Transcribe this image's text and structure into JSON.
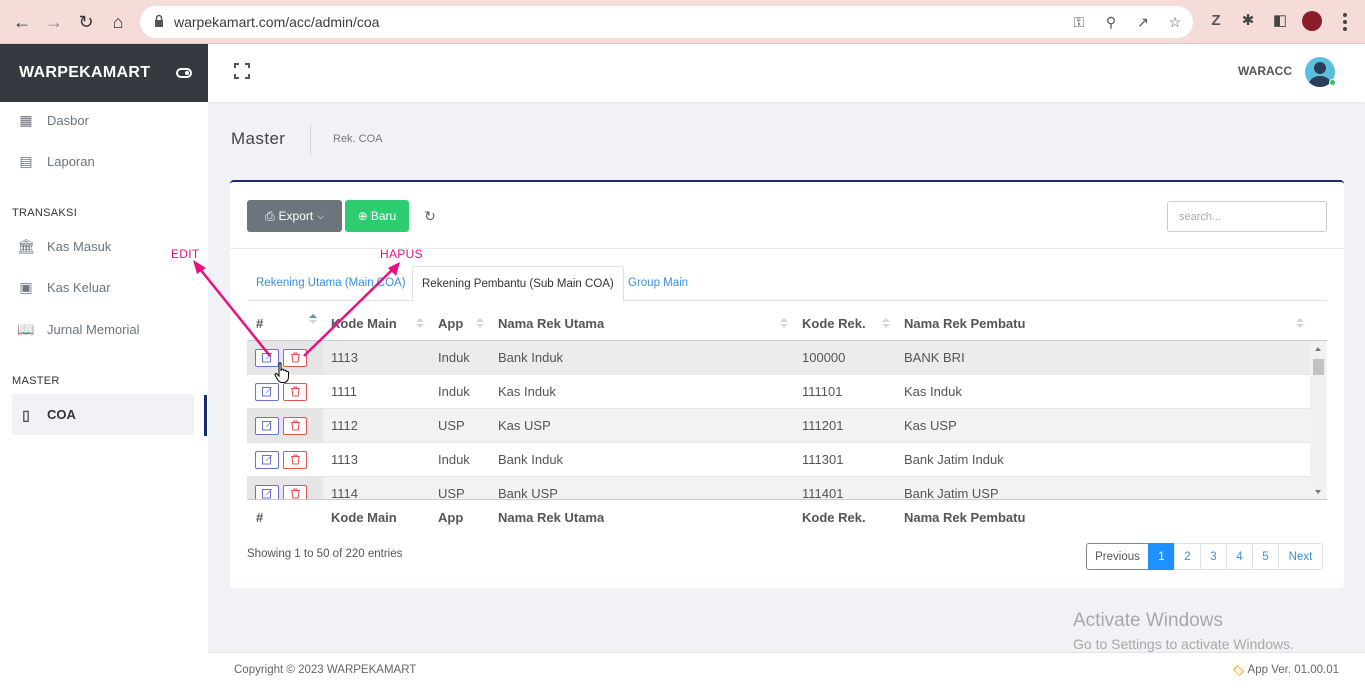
{
  "browser": {
    "url": "warpekamart.com/acc/admin/coa"
  },
  "sidebar": {
    "brand": "WARPEKAMART",
    "items_top": [
      {
        "label": "Dasbor",
        "icon": "dashboard-icon"
      },
      {
        "label": "Laporan",
        "icon": "clipboard-icon"
      }
    ],
    "section_transaksi": "TRANSAKSI",
    "items_transaksi": [
      {
        "label": "Kas Masuk",
        "icon": "bank-icon"
      },
      {
        "label": "Kas Keluar",
        "icon": "money-icon"
      },
      {
        "label": "Jurnal Memorial",
        "icon": "book-icon"
      }
    ],
    "section_master": "MASTER",
    "items_master": [
      {
        "label": "COA",
        "icon": "notebook-icon",
        "active": true
      }
    ]
  },
  "topbar": {
    "user": "WARACC"
  },
  "page": {
    "title": "Master",
    "crumb": "Rek. COA"
  },
  "toolbar": {
    "export_label": "Export",
    "baru_label": "Baru",
    "search_placeholder": "search..."
  },
  "tabs": [
    {
      "label": "Rekening Utama (Main COA)",
      "active": false
    },
    {
      "label": "Rekening Pembantu (Sub Main COA)",
      "active": true
    },
    {
      "label": "Group Main",
      "active": false
    }
  ],
  "table": {
    "columns": [
      "#",
      "Kode Main",
      "App",
      "Nama Rek Utama",
      "Kode Rek.",
      "Nama Rek Pembatu"
    ],
    "rows": [
      [
        "1113",
        "Induk",
        "Bank Induk",
        "100000",
        "BANK BRI"
      ],
      [
        "1111",
        "Induk",
        "Kas Induk",
        "111101",
        "Kas Induk"
      ],
      [
        "1112",
        "USP",
        "Kas USP",
        "111201",
        "Kas USP"
      ],
      [
        "1113",
        "Induk",
        "Bank Induk",
        "111301",
        "Bank Jatim Induk"
      ],
      [
        "1114",
        "USP",
        "Bank USP",
        "111401",
        "Bank Jatim USP"
      ]
    ]
  },
  "info": "Showing 1 to 50 of 220 entries",
  "pagination": {
    "previous": "Previous",
    "pages": [
      "1",
      "2",
      "3",
      "4",
      "5"
    ],
    "current": "1",
    "next": "Next"
  },
  "footer": {
    "copyright": "Copyright © 2023 WARPEKAMART",
    "version": "App Ver. 01.00.01"
  },
  "watermark": {
    "line1": "Activate Windows",
    "line2": "Go to Settings to activate Windows."
  },
  "annotations": {
    "edit": "EDIT",
    "hapus": "HAPUS",
    "color": "#e8117f"
  }
}
